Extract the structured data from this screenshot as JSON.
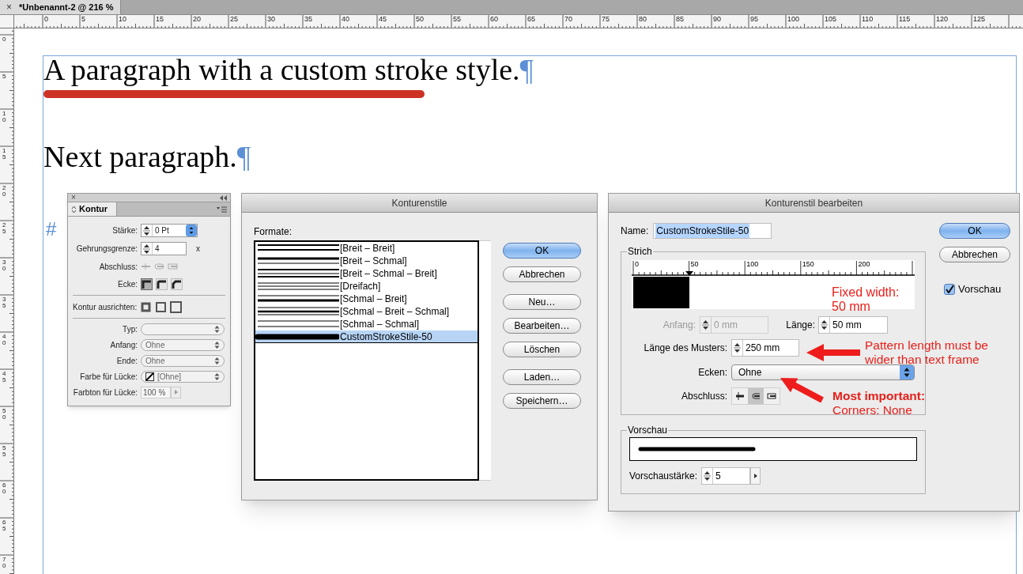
{
  "document_tab": {
    "title": "*Unbenannt-2 @ 216 %",
    "close_glyph": "×"
  },
  "rulers": {
    "horizontal": [
      "0",
      "5",
      "10",
      "15",
      "20",
      "25",
      "30",
      "35",
      "40",
      "45",
      "50",
      "55",
      "60",
      "65",
      "70",
      "75",
      "80",
      "85",
      "90",
      "95",
      "100",
      "105",
      "110",
      "115",
      "120",
      "125"
    ],
    "vertical": [
      "0",
      "5",
      "10",
      "15",
      "20",
      "25",
      "30",
      "35",
      "40",
      "45",
      "50",
      "55",
      "60",
      "65",
      "70"
    ]
  },
  "document": {
    "paragraphs": [
      {
        "text": "A paragraph with a custom stroke style.",
        "pilcrow": "¶",
        "paragraph_rule": true
      },
      {
        "text": "Next paragraph.",
        "pilcrow": "¶",
        "paragraph_rule": false
      }
    ],
    "overset_mark": "#"
  },
  "stroke_panel": {
    "close_glyph": "×",
    "tab": "Kontur",
    "weight": {
      "label": "Stärke:",
      "value": "0 Pt"
    },
    "miter_limit": {
      "label": "Gehrungsgrenze:",
      "value": "4",
      "unit": "x"
    },
    "cap": {
      "label": "Abschluss:",
      "disabled": true
    },
    "join": {
      "label": "Ecke:",
      "options": [
        {
          "selected": true
        },
        {
          "selected": false
        },
        {
          "selected": false
        }
      ]
    },
    "align": {
      "label": "Kontur ausrichten:"
    },
    "selects": [
      {
        "kind": "plain",
        "label": "Typ:"
      },
      {
        "kind": "plain",
        "label": "Anfang:",
        "value": "Ohne"
      },
      {
        "kind": "plain",
        "label": "Ende:",
        "value": "Ohne"
      },
      {
        "kind": "swatch",
        "label": "Farbe für Lücke:",
        "value": "[Ohne]"
      }
    ],
    "gap_tint": {
      "label": "Farbton für Lücke:",
      "value": "100 %"
    }
  },
  "styles_dialog": {
    "title": "Konturenstile",
    "list_label": "Formate:",
    "styles": [
      {
        "label": "[Breit – Breit]",
        "kind": "thick-thick",
        "selected": false
      },
      {
        "label": "[Breit – Schmal]",
        "kind": "thick-thin",
        "selected": false
      },
      {
        "label": "[Breit – Schmal – Breit]",
        "kind": "thick-thin-thick",
        "selected": false
      },
      {
        "label": "[Dreifach]",
        "kind": "triple",
        "selected": false
      },
      {
        "label": "[Schmal – Breit]",
        "kind": "thin-thick",
        "selected": false
      },
      {
        "label": "[Schmal – Breit – Schmal]",
        "kind": "thin-thick-thin",
        "selected": false
      },
      {
        "label": "[Schmal – Schmal]",
        "kind": "thin-thin",
        "selected": false
      },
      {
        "label": "CustomStrokeStile-50",
        "kind": "custom",
        "selected": true
      }
    ],
    "button_groups": [
      [
        {
          "label": "OK",
          "default": true
        },
        {
          "label": "Abbrechen",
          "default": false
        }
      ],
      [
        {
          "label": "Neu…",
          "default": false
        },
        {
          "label": "Bearbeiten…",
          "default": false
        },
        {
          "label": "Löschen",
          "default": false
        }
      ],
      [
        {
          "label": "Laden…",
          "default": false
        },
        {
          "label": "Speichern…",
          "default": false
        }
      ]
    ]
  },
  "edit_dialog": {
    "title": "Konturenstil bearbeiten",
    "name": {
      "label": "Name:",
      "value": "CustomStrokeStile-50"
    },
    "stroke_group": {
      "legend": "Strich",
      "ruler_labels": [
        "0",
        "50",
        "100",
        "150",
        "200"
      ],
      "start": {
        "label": "Anfang:",
        "value": "0 mm",
        "disabled": true
      },
      "length": {
        "label": "Länge:",
        "value": "50 mm",
        "disabled": false
      },
      "pattern_length": {
        "label": "Länge des Musters:",
        "value": "250 mm"
      },
      "corners": {
        "label": "Ecken:",
        "value": "Ohne"
      },
      "cap": {
        "label": "Abschluss:",
        "options": [
          {
            "selected": false
          },
          {
            "selected": true
          },
          {
            "selected": false
          }
        ]
      }
    },
    "preview_group": {
      "legend": "Vorschau",
      "weight": {
        "label": "Vorschaustärke:",
        "value": "5"
      }
    },
    "buttons": [
      {
        "label": "OK",
        "default": true
      },
      {
        "label": "Abbrechen",
        "default": false
      }
    ],
    "preview_checkbox": {
      "label": "Vorschau",
      "checked": true
    }
  },
  "annotations": [
    {
      "kind": "note",
      "text": "Fixed width: 50 mm"
    },
    {
      "kind": "arrow-note",
      "text": "Pattern length must be wider than text frame"
    },
    {
      "kind": "arrow-emphasis",
      "title": "Most important:",
      "text": "Corners: None"
    }
  ]
}
